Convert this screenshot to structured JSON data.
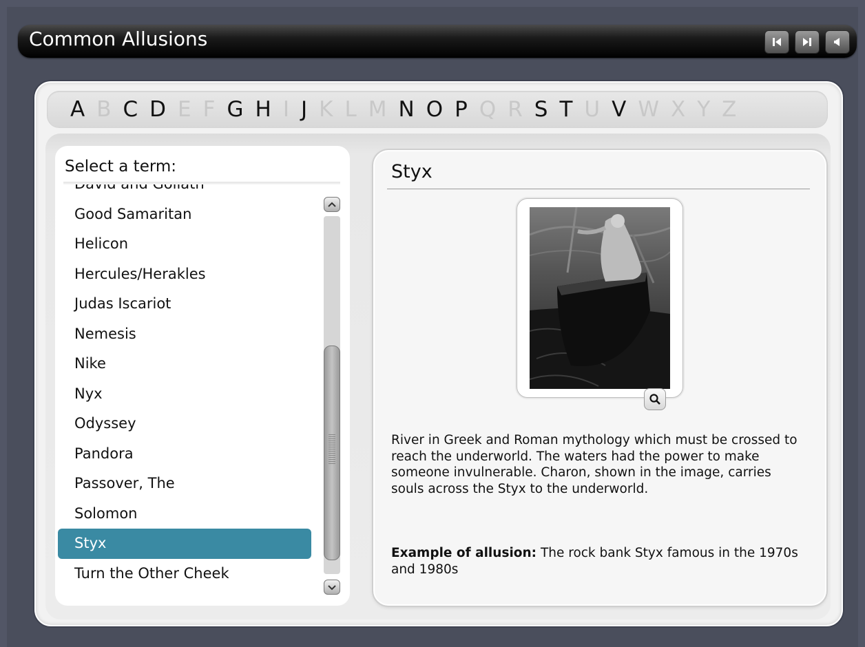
{
  "app": {
    "title": "Common Allusions",
    "nav": [
      {
        "name": "previous-button",
        "icon": "previous-icon"
      },
      {
        "name": "next-button",
        "icon": "next-icon"
      },
      {
        "name": "audio-button",
        "icon": "speaker-icon"
      }
    ]
  },
  "alphabet": [
    {
      "letter": "A",
      "enabled": true
    },
    {
      "letter": "B",
      "enabled": false
    },
    {
      "letter": "C",
      "enabled": true
    },
    {
      "letter": "D",
      "enabled": true
    },
    {
      "letter": "E",
      "enabled": false
    },
    {
      "letter": "F",
      "enabled": false
    },
    {
      "letter": "G",
      "enabled": true
    },
    {
      "letter": "H",
      "enabled": true
    },
    {
      "letter": "I",
      "enabled": false
    },
    {
      "letter": "J",
      "enabled": true
    },
    {
      "letter": "K",
      "enabled": false
    },
    {
      "letter": "L",
      "enabled": false
    },
    {
      "letter": "M",
      "enabled": false
    },
    {
      "letter": "N",
      "enabled": true
    },
    {
      "letter": "O",
      "enabled": true
    },
    {
      "letter": "P",
      "enabled": true
    },
    {
      "letter": "Q",
      "enabled": false
    },
    {
      "letter": "R",
      "enabled": false
    },
    {
      "letter": "S",
      "enabled": true
    },
    {
      "letter": "T",
      "enabled": true
    },
    {
      "letter": "U",
      "enabled": false
    },
    {
      "letter": "V",
      "enabled": true
    },
    {
      "letter": "W",
      "enabled": false
    },
    {
      "letter": "X",
      "enabled": false
    },
    {
      "letter": "Y",
      "enabled": false
    },
    {
      "letter": "Z",
      "enabled": false
    }
  ],
  "term_list": {
    "heading": "Select a term:",
    "selected": "Styx",
    "items": [
      "David and Goliath",
      "Good Samaritan",
      "Helicon",
      "Hercules/Herakles",
      "Judas Iscariot",
      "Nemesis",
      "Nike",
      "Nyx",
      "Odyssey",
      "Pandora",
      "Passover, The",
      "Solomon",
      "Styx",
      "Turn the Other Cheek"
    ]
  },
  "detail": {
    "title": "Styx",
    "image_alt": "Charon ferrying across the river Styx",
    "zoom_icon": "magnifier-icon",
    "description": "River in Greek and Roman mythology which must be crossed to reach the underworld. The waters had the power to make someone invulnerable. Charon, shown in the image, carries souls across the Styx to the underworld.",
    "example_label": "Example of allusion:",
    "example_text": " The rock bank Styx famous in the 1970s and 1980s"
  },
  "colors": {
    "selected_row": "#3a8aa3",
    "background": "#525666"
  }
}
